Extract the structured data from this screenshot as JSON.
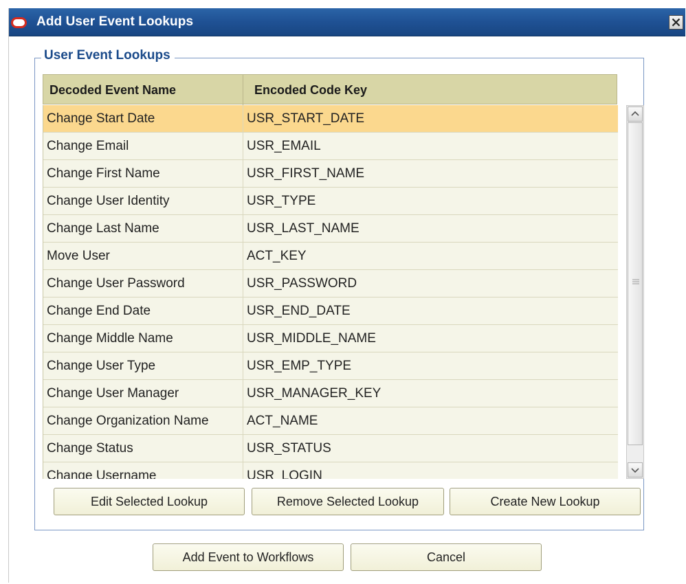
{
  "window": {
    "title": "Add User Event Lookups",
    "icon": "oracle-logo-icon",
    "close_icon": "close-icon"
  },
  "group": {
    "legend": "User Event Lookups"
  },
  "table": {
    "columns": [
      "Decoded Event Name",
      "Encoded Code Key"
    ],
    "selected_row": 0,
    "rows": [
      {
        "name": "Change Start Date",
        "key": "USR_START_DATE"
      },
      {
        "name": "Change Email",
        "key": "USR_EMAIL"
      },
      {
        "name": "Change First Name",
        "key": "USR_FIRST_NAME"
      },
      {
        "name": "Change User Identity",
        "key": "USR_TYPE"
      },
      {
        "name": "Change Last Name",
        "key": "USR_LAST_NAME"
      },
      {
        "name": "Move User",
        "key": "ACT_KEY"
      },
      {
        "name": "Change User Password",
        "key": "USR_PASSWORD"
      },
      {
        "name": "Change End Date",
        "key": "USR_END_DATE"
      },
      {
        "name": "Change Middle Name",
        "key": "USR_MIDDLE_NAME"
      },
      {
        "name": "Change User Type",
        "key": "USR_EMP_TYPE"
      },
      {
        "name": "Change User Manager",
        "key": "USR_MANAGER_KEY"
      },
      {
        "name": "Change Organization Name",
        "key": "ACT_NAME"
      },
      {
        "name": "Change Status",
        "key": "USR_STATUS"
      },
      {
        "name": "Change Username",
        "key": "USR_LOGIN"
      }
    ]
  },
  "buttons": {
    "edit": "Edit Selected Lookup",
    "remove": "Remove Selected Lookup",
    "create": "Create New Lookup",
    "add": "Add Event to Workflows",
    "cancel": "Cancel"
  },
  "colors": {
    "titlebar": "#1f5194",
    "header_bg": "#d8d6a6",
    "row_bg": "#f5f5e8",
    "selected_row_bg": "#fbd88e",
    "legend_text": "#1a4a8a"
  }
}
